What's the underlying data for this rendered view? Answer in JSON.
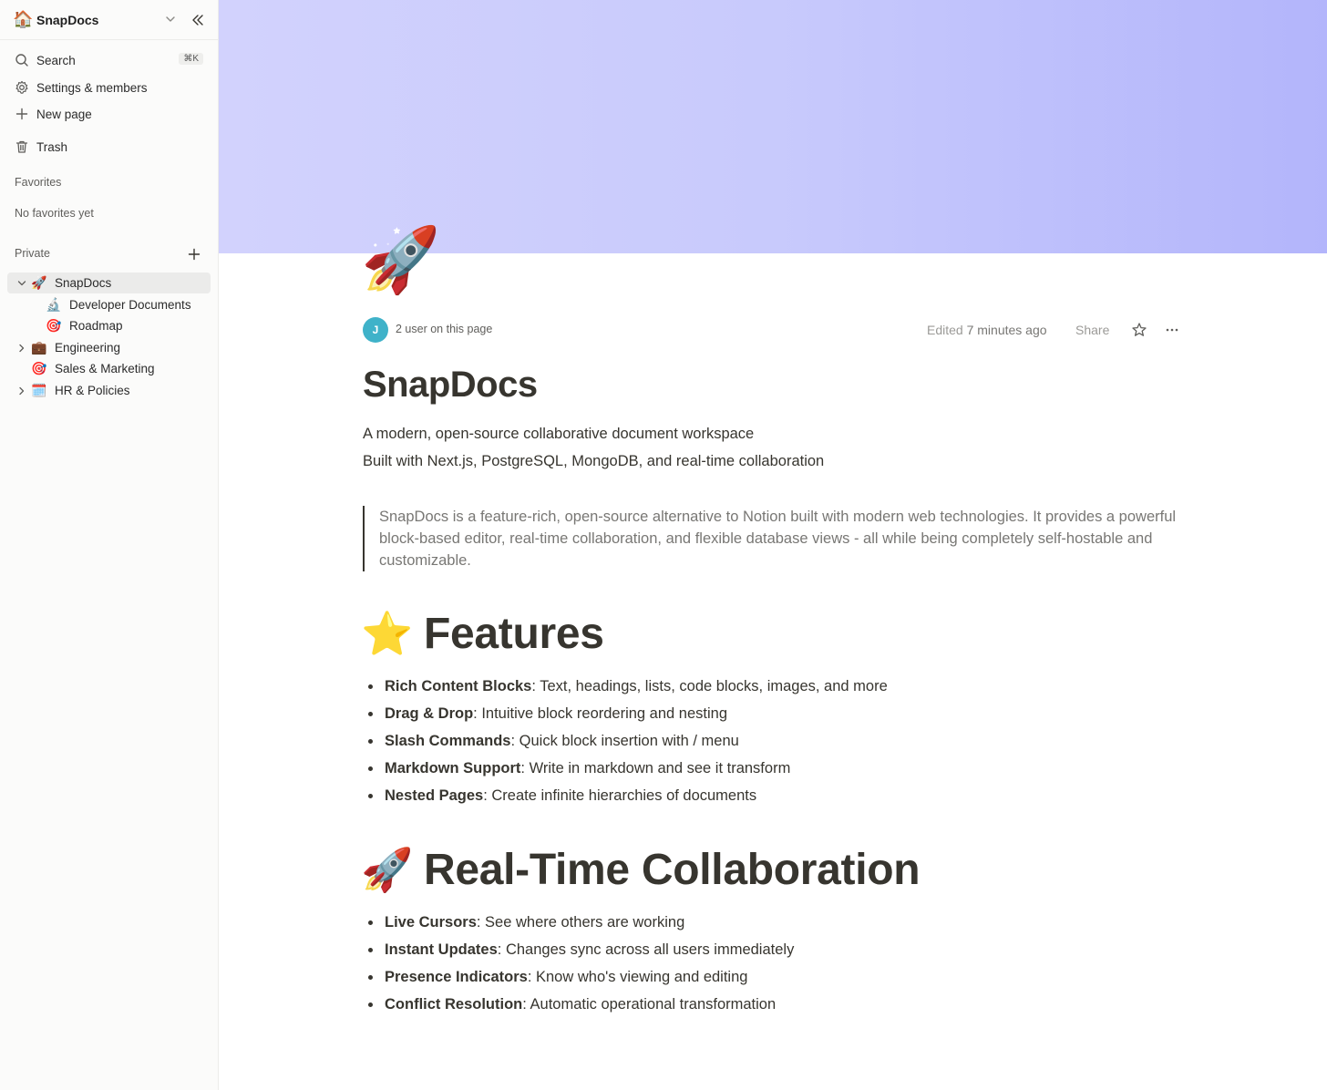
{
  "sidebar": {
    "workspace": {
      "emoji": "🏠",
      "name": "SnapDocs"
    },
    "nav": [
      {
        "label": "Search",
        "shortcut": "⌘K",
        "icon": "search-icon"
      },
      {
        "label": "Settings & members",
        "icon": "gear-icon"
      },
      {
        "label": "New page",
        "icon": "plus-icon"
      },
      {
        "label": "Trash",
        "icon": "trash-icon"
      }
    ],
    "favorites_label": "Favorites",
    "favorites_empty": "No favorites yet",
    "private_label": "Private",
    "tree": [
      {
        "emoji": "🚀",
        "label": "SnapDocs",
        "expanded": true,
        "active": true
      },
      {
        "emoji": "🔬",
        "label": "Developer Documents"
      },
      {
        "emoji": "🎯",
        "label": "Roadmap"
      },
      {
        "emoji": "💼",
        "label": "Engineering",
        "expanded": false
      },
      {
        "emoji": "🎯",
        "label": "Sales & Marketing"
      },
      {
        "emoji": "🗓️",
        "label": "HR & Policies",
        "expanded": false
      }
    ]
  },
  "page": {
    "cover_colors": [
      "#d2d2fd",
      "#b3b5fb"
    ],
    "icon": "🚀",
    "avatar_initial": "J",
    "users_text": "2 user on this page",
    "edited_prefix": "Edited",
    "edited_time": "7 minutes ago",
    "share_label": "Share",
    "title": "SnapDocs",
    "subtitle_1": "A modern, open-source collaborative document workspace",
    "subtitle_2": "Built with Next.js, PostgreSQL, MongoDB, and real-time collaboration",
    "quote": "SnapDocs is a feature-rich, open-source alternative to Notion built with modern web technologies. It provides a powerful block-based editor, real-time collaboration, and flexible database views - all while being completely self-hostable and customizable.",
    "sections": [
      {
        "emoji": "⭐",
        "heading": "Features",
        "items": [
          {
            "bold": "Rich Content Blocks",
            "text": ": Text, headings, lists, code blocks, images, and more"
          },
          {
            "bold": "Drag & Drop",
            "text": ": Intuitive block reordering and nesting"
          },
          {
            "bold": "Slash Commands",
            "text": ": Quick block insertion with / menu"
          },
          {
            "bold": "Markdown Support",
            "text": ": Write in markdown and see it transform"
          },
          {
            "bold": "Nested Pages",
            "text": ": Create infinite hierarchies of documents"
          }
        ]
      },
      {
        "emoji": "🚀",
        "heading": "Real-Time Collaboration",
        "items": [
          {
            "bold": "Live Cursors",
            "text": ": See where others are working"
          },
          {
            "bold": "Instant Updates",
            "text": ": Changes sync across all users immediately"
          },
          {
            "bold": "Presence Indicators",
            "text": ": Know who's viewing and editing"
          },
          {
            "bold": "Conflict Resolution",
            "text": ": Automatic operational transformation"
          }
        ]
      }
    ]
  }
}
